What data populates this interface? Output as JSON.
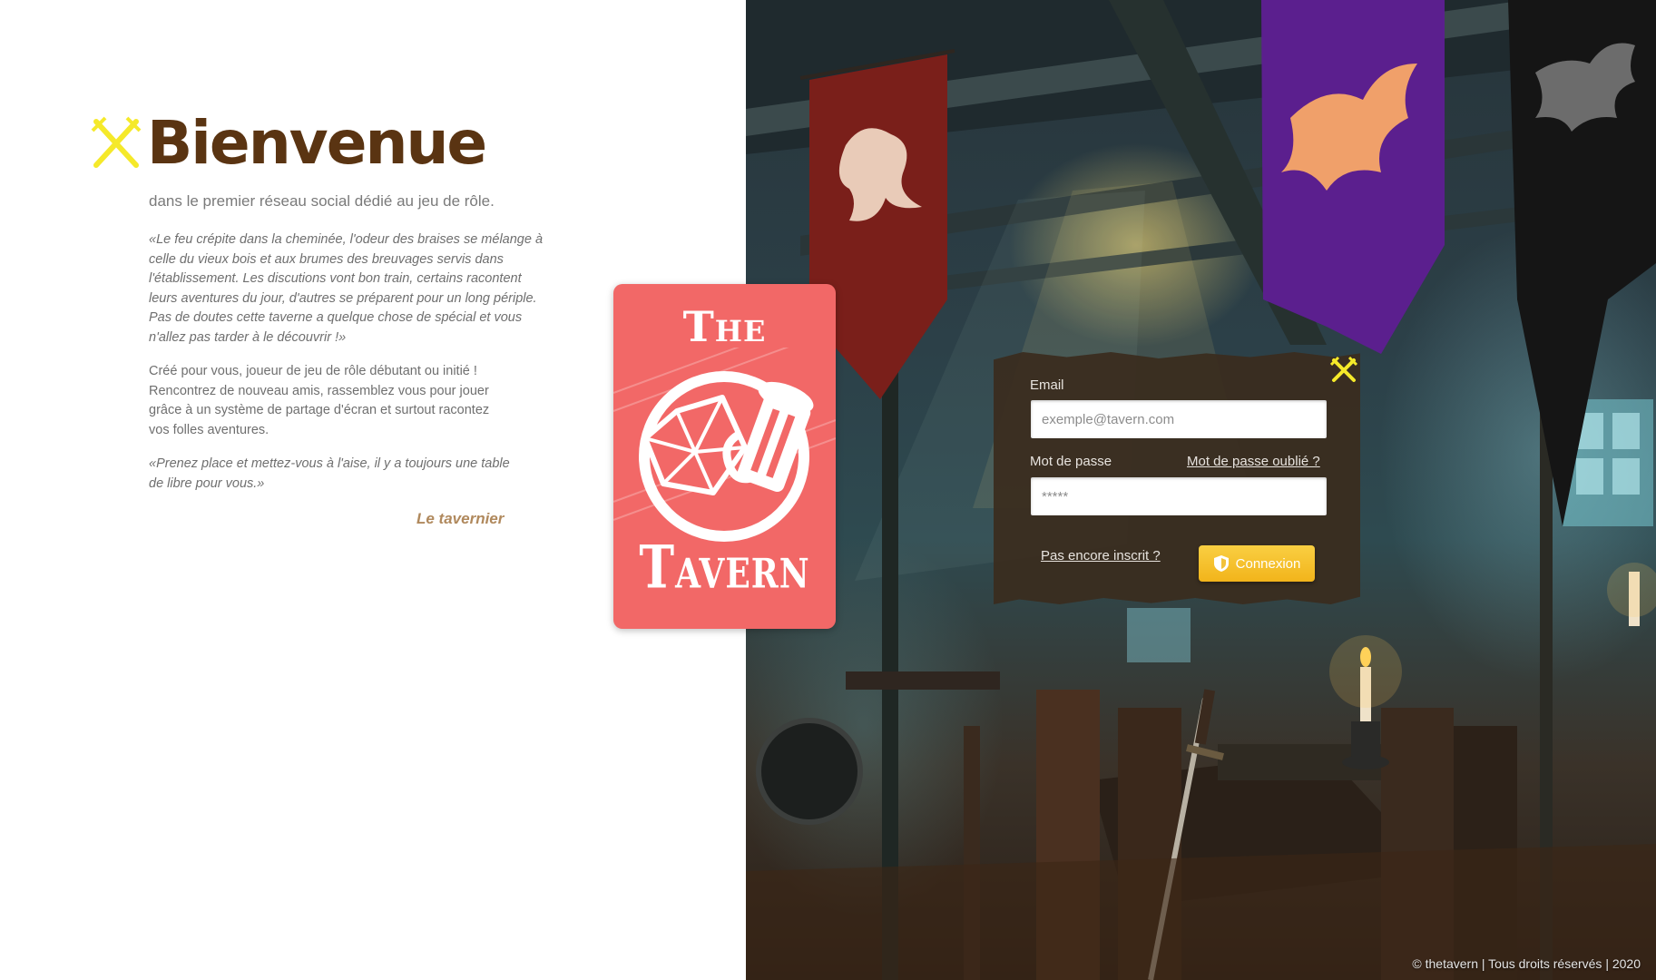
{
  "welcome": {
    "title": "Bienvenue",
    "subtitle": "dans le premier réseau social dédié au jeu de rôle.",
    "quote": "«Le feu crépite dans la cheminée, l'odeur des braises se mélange à celle du vieux bois et aux brumes des breuvages servis dans l'établissement. Les discutions vont bon train, certains racontent leurs aventures du jour, d'autres se préparent pour un long périple. Pas de doutes cette taverne a quelque chose de spécial et vous n'allez pas tarder à le découvrir !»",
    "description": "Créé pour vous, joueur de jeu de rôle débutant ou initié ! Rencontrez de nouveau amis, rassemblez vous pour jouer grâce à un système de partage d'écran et surtout racontez vos folles aventures.",
    "invitation": "«Prenez place et mettez-vous à l'aise, il y a toujours une table de libre pour vous.»",
    "signature": "Le tavernier"
  },
  "logo": {
    "line1": "The",
    "line2": "Tavern",
    "background_color": "#f26867"
  },
  "login": {
    "email_label": "Email",
    "email_placeholder": "exemple@tavern.com",
    "password_label": "Mot de passe",
    "password_placeholder": "*****",
    "forgot_password": "Mot de passe oublié ?",
    "signup_link": "Pas encore inscrit ?",
    "submit_label": "Connexion",
    "accent_color": "#f7c22b"
  },
  "footer": {
    "text": "© thetavern | Tous droits réservés | 2020"
  },
  "icons": [
    "crossed-swords-icon",
    "shield-icon",
    "close-icon",
    "dice-icon",
    "mug-icon"
  ]
}
